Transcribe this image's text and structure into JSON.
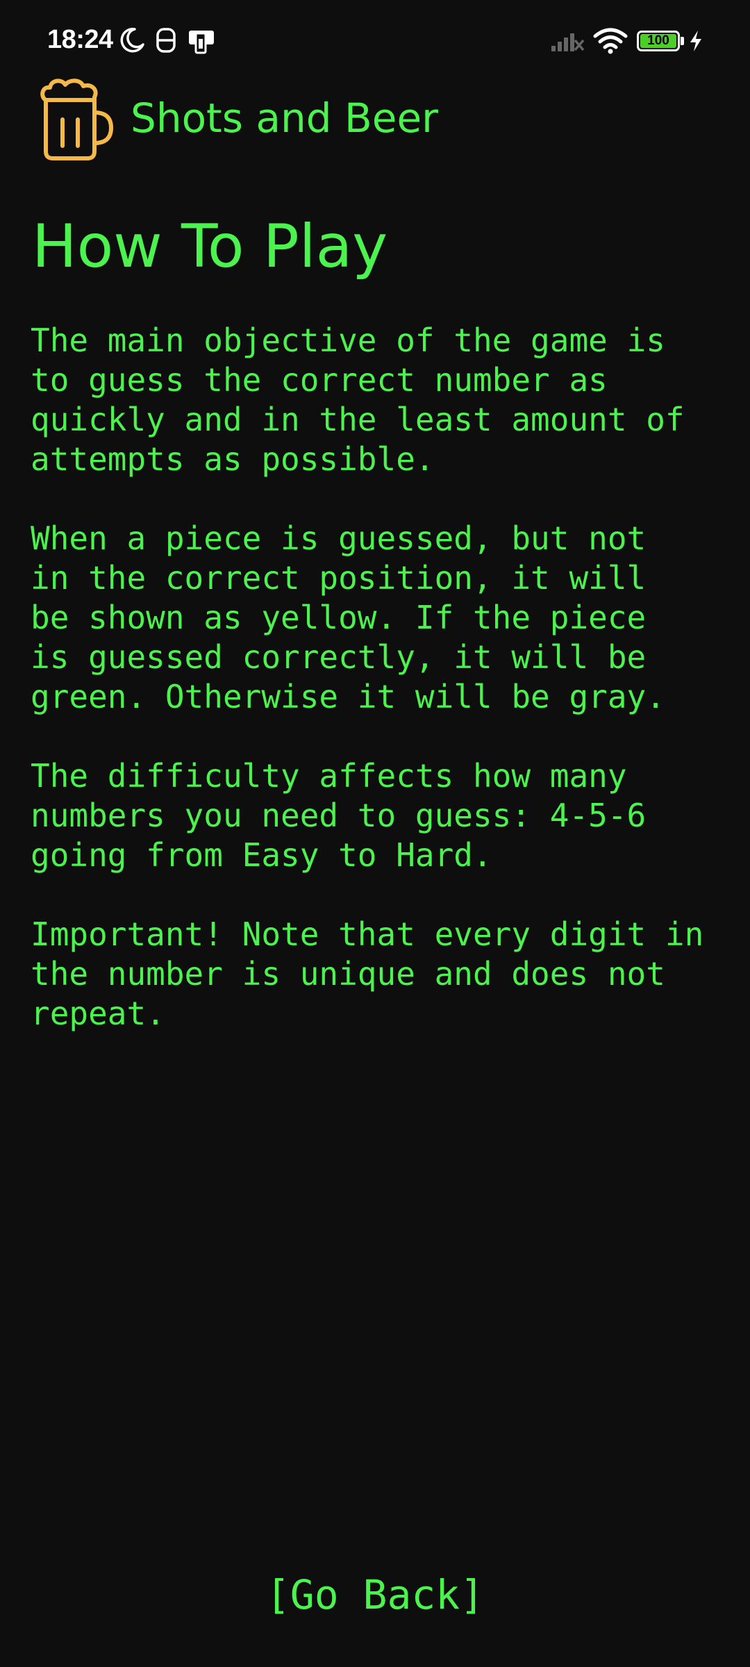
{
  "status_bar": {
    "time": "18:24",
    "battery_level": "100",
    "icons": [
      "moon-icon",
      "data-saver-icon",
      "sim-card-icon",
      "signal-icon",
      "wifi-icon",
      "battery-icon",
      "charging-bolt-icon"
    ]
  },
  "app": {
    "name": "Shots and Beer",
    "logo_icon": "beer-mug-icon"
  },
  "page": {
    "title": "How To Play",
    "paragraphs": [
      "The main objective of the game is\nto guess the correct number as\nquickly and in the least amount of\nattempts as possible.",
      "When a piece is guessed, but not\nin the correct position, it will\nbe shown as yellow. If the piece\nis guessed correctly, it will be\ngreen. Otherwise it will be gray.",
      "The difficulty affects how many\nnumbers you need to guess: 4-5-6\ngoing from Easy to Hard.",
      "Important! Note that every digit in\nthe number is unique and does not\nrepeat."
    ]
  },
  "actions": {
    "go_back_label": "[Go Back]"
  },
  "colors": {
    "background": "#0e0e0e",
    "accent_green": "#4cf24e",
    "logo_orange": "#f5b94a"
  }
}
